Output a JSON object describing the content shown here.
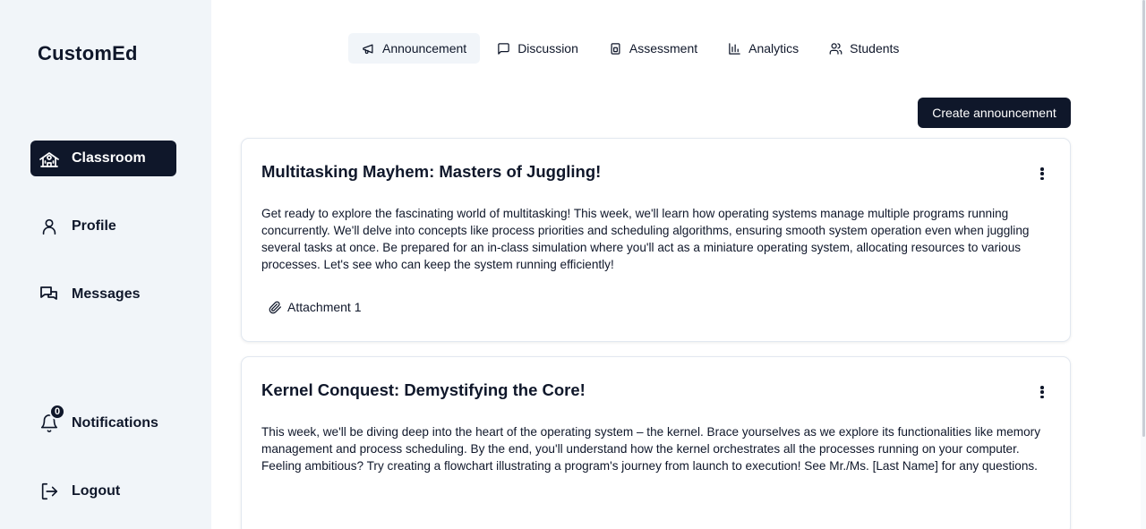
{
  "app": {
    "brand": "CustomEd"
  },
  "sidebar": {
    "items": [
      {
        "label": "Classroom",
        "icon": "school-icon",
        "active": true
      },
      {
        "label": "Profile",
        "icon": "user-icon"
      },
      {
        "label": "Messages",
        "icon": "messages-icon"
      }
    ],
    "notifications": {
      "label": "Notifications",
      "icon": "bell-icon",
      "count": "0"
    },
    "logout": {
      "label": "Logout",
      "icon": "logout-icon"
    }
  },
  "tabs": [
    {
      "label": "Announcement",
      "icon": "megaphone-icon",
      "active": true
    },
    {
      "label": "Discussion",
      "icon": "message-square-icon"
    },
    {
      "label": "Assessment",
      "icon": "clipboard-icon"
    },
    {
      "label": "Analytics",
      "icon": "bar-chart-icon"
    },
    {
      "label": "Students",
      "icon": "users-icon"
    }
  ],
  "actions": {
    "create_label": "Create announcement"
  },
  "announcements": [
    {
      "title": "Multitasking Mayhem: Masters of Juggling!",
      "body": "Get ready to explore the fascinating world of multitasking! This week, we'll learn how operating systems manage multiple programs running concurrently. We'll delve into concepts like process priorities and scheduling algorithms, ensuring smooth system operation even when juggling several tasks at once. Be prepared for an in-class simulation where you'll act as a miniature operating system, allocating resources to various processes. Let's see who can keep the system running efficiently!",
      "attachment": "Attachment 1"
    },
    {
      "title": "Kernel Conquest: Demystifying the Core!",
      "body": "This week, we'll be diving deep into the heart of the operating system – the kernel. Brace yourselves as we explore its functionalities like memory management and process scheduling. By the end, you'll understand how the kernel orchestrates all the processes running on your computer. Feeling ambitious? Try creating a flowchart illustrating a program's journey from launch to execution! See Mr./Ms. [Last Name] for any questions."
    }
  ],
  "colors": {
    "primary": "#0f172a",
    "sidebar_bg": "#f1f5f9",
    "border": "#e2e8f0"
  }
}
